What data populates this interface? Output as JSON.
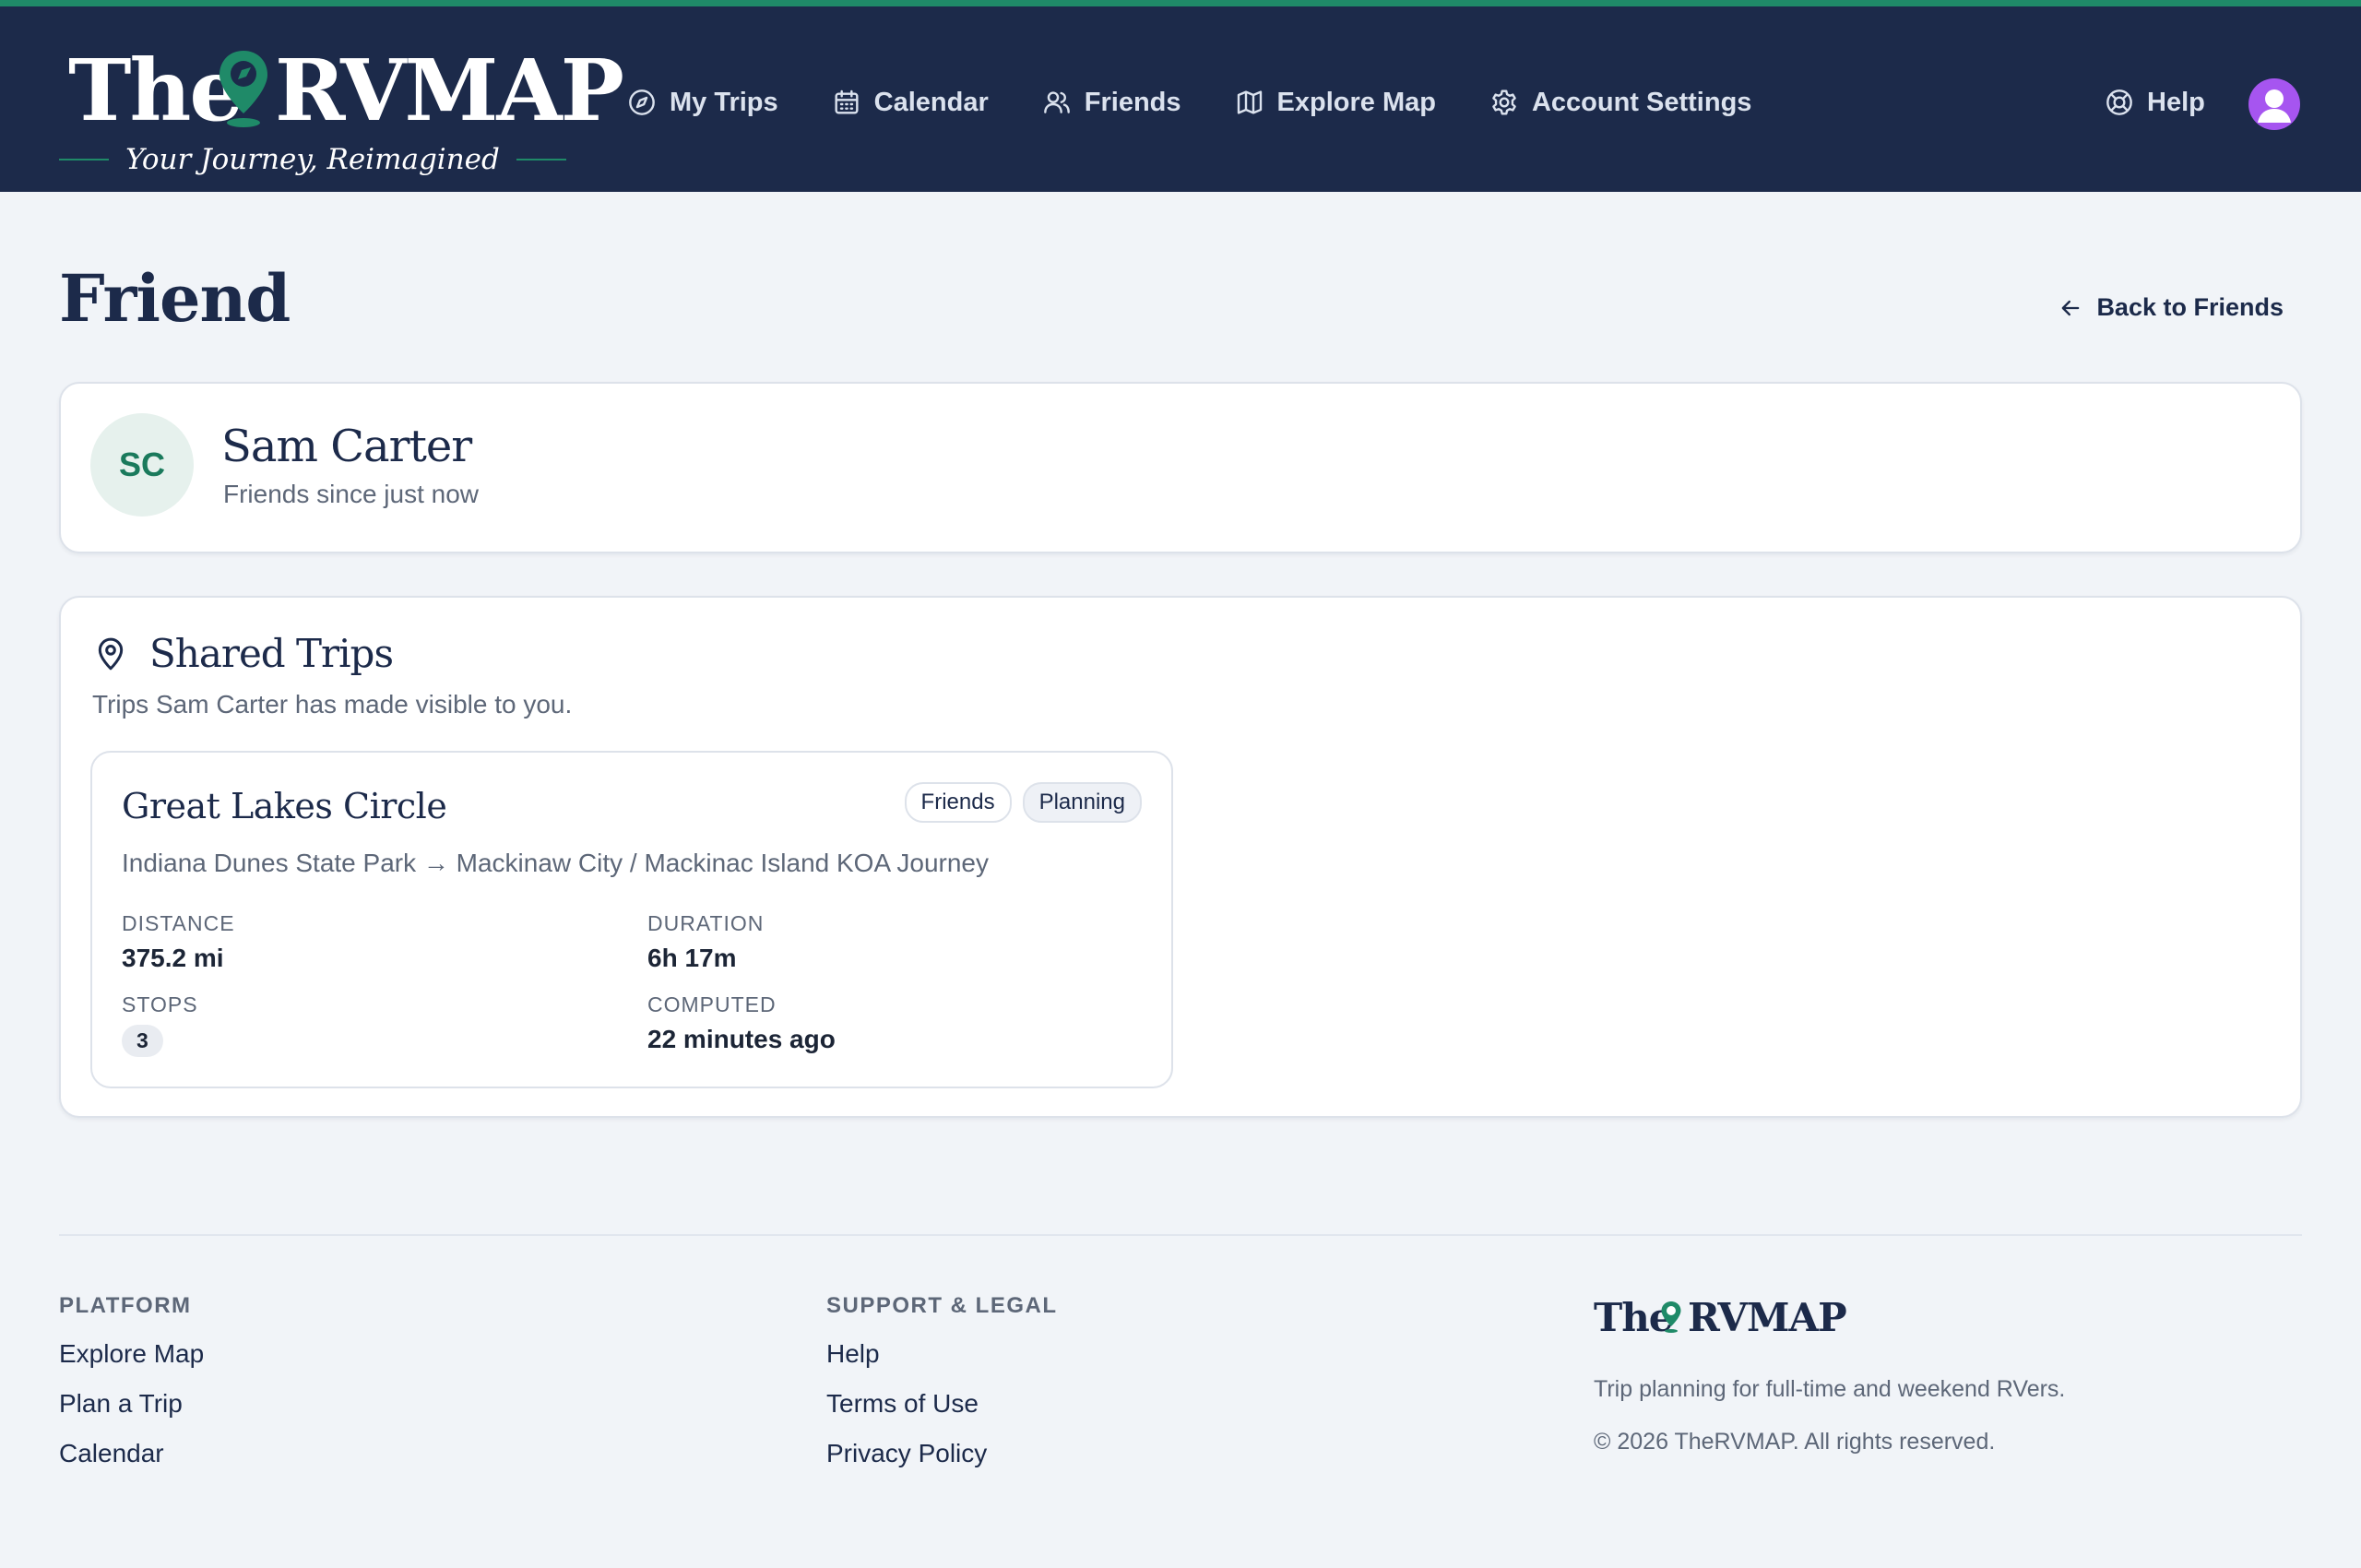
{
  "header": {
    "logo_the": "The",
    "logo_rvmap": "RVMAP",
    "tagline": "Your Journey, Reimagined",
    "nav": [
      {
        "label": "My Trips",
        "icon": "compass-icon"
      },
      {
        "label": "Calendar",
        "icon": "calendar-icon"
      },
      {
        "label": "Friends",
        "icon": "users-icon"
      },
      {
        "label": "Explore Map",
        "icon": "map-icon"
      },
      {
        "label": "Account Settings",
        "icon": "gear-icon"
      }
    ],
    "help_label": "Help"
  },
  "page": {
    "title": "Friend",
    "back_label": "Back to Friends"
  },
  "friend": {
    "initials": "SC",
    "name": "Sam Carter",
    "since": "Friends since just now"
  },
  "shared_trips": {
    "title": "Shared Trips",
    "subtitle": "Trips Sam Carter has made visible to you.",
    "trips": [
      {
        "name": "Great Lakes Circle",
        "visibility": "Friends",
        "status": "Planning",
        "route": "Indiana Dunes State Park → Mackinaw City / Mackinac Island KOA Journey",
        "distance_label": "DISTANCE",
        "distance": "375.2 mi",
        "duration_label": "DURATION",
        "duration": "6h 17m",
        "stops_label": "STOPS",
        "stops": "3",
        "computed_label": "COMPUTED",
        "computed": "22 minutes ago"
      }
    ]
  },
  "footer": {
    "platform_head": "PLATFORM",
    "platform_links": [
      "Explore Map",
      "Plan a Trip",
      "Calendar"
    ],
    "support_head": "SUPPORT & LEGAL",
    "support_links": [
      "Help",
      "Terms of Use",
      "Privacy Policy"
    ],
    "brand_the": "The",
    "brand_rvmap": "RVMAP",
    "brand_tagline": "Trip planning for full-time and weekend RVers.",
    "copyright": "© 2026 TheRVMAP. All rights reserved."
  },
  "colors": {
    "header_bg": "#1c2a4a",
    "accent_green": "#1f8a68",
    "avatar_purple": "#a655f0",
    "page_bg": "#f1f4f8"
  }
}
